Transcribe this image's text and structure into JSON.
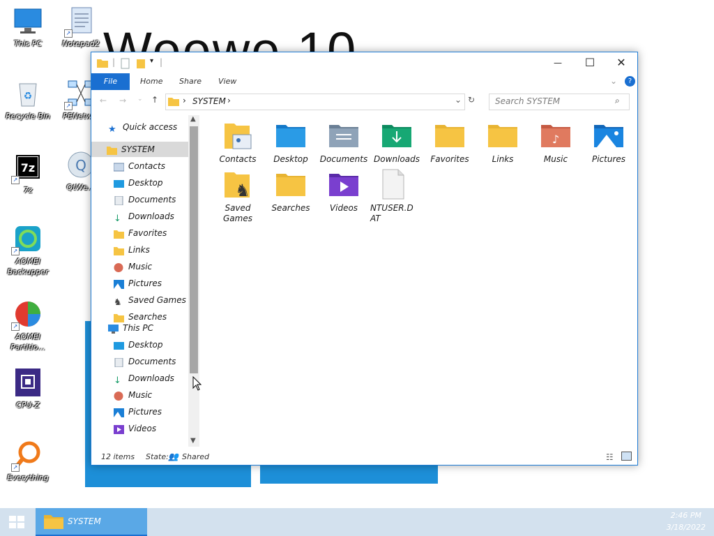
{
  "desktop": {
    "wallpaper_text": "Weewe 10",
    "icons": [
      {
        "name": "this-pc",
        "label": "This PC"
      },
      {
        "name": "notepad2",
        "label": "Notepad2"
      },
      {
        "name": "recycle-bin",
        "label": "Recycle Bin"
      },
      {
        "name": "penetwork",
        "label": "PENetw..."
      },
      {
        "name": "7z",
        "label": "7z"
      },
      {
        "name": "qtweb",
        "label": "QtWe..."
      },
      {
        "name": "aomei-backupper",
        "label": "AOMEI Backupper"
      },
      {
        "name": "aomei-partition",
        "label": "AOMEI Partitio..."
      },
      {
        "name": "cpu-z",
        "label": "CPU-Z"
      },
      {
        "name": "everything",
        "label": "Everything"
      }
    ]
  },
  "window": {
    "title_buttons": {
      "minimize": "—",
      "maximize": "☐",
      "close": "✕"
    },
    "ribbon_tabs": [
      "File",
      "Home",
      "Share",
      "View"
    ],
    "address": {
      "path": "SYSTEM",
      "separator": "›"
    },
    "search": {
      "placeholder": "Search SYSTEM"
    },
    "nav": {
      "quick_access": "Quick access",
      "system": "SYSTEM",
      "system_children": [
        "Contacts",
        "Desktop",
        "Documents",
        "Downloads",
        "Favorites",
        "Links",
        "Music",
        "Pictures",
        "Saved Games",
        "Searches"
      ],
      "this_pc": "This PC",
      "this_pc_children": [
        "Desktop",
        "Documents",
        "Downloads",
        "Music",
        "Pictures",
        "Videos"
      ]
    },
    "files": [
      {
        "label": "Contacts",
        "icon": "contacts-folder-icon"
      },
      {
        "label": "Desktop",
        "icon": "desktop-folder-icon"
      },
      {
        "label": "Documents",
        "icon": "documents-folder-icon"
      },
      {
        "label": "Downloads",
        "icon": "downloads-folder-icon"
      },
      {
        "label": "Favorites",
        "icon": "folder-icon"
      },
      {
        "label": "Links",
        "icon": "folder-icon"
      },
      {
        "label": "Music",
        "icon": "music-folder-icon"
      },
      {
        "label": "Pictures",
        "icon": "pictures-folder-icon"
      },
      {
        "label": "Saved Games",
        "icon": "saved-games-folder-icon"
      },
      {
        "label": "Searches",
        "icon": "folder-icon"
      },
      {
        "label": "Videos",
        "icon": "videos-folder-icon"
      },
      {
        "label": "NTUSER.DAT",
        "icon": "file-icon"
      }
    ],
    "status": {
      "count": "12 items",
      "state_label": "State:",
      "state_value": "Shared"
    }
  },
  "taskbar": {
    "task_label": "SYSTEM",
    "time": "2:46 PM",
    "date": "3/18/2022"
  },
  "colors": {
    "accent": "#1a6fd1",
    "folder": "#f6c443",
    "taskbar": "#d3e1ee",
    "tile": "#1d8fd8"
  }
}
